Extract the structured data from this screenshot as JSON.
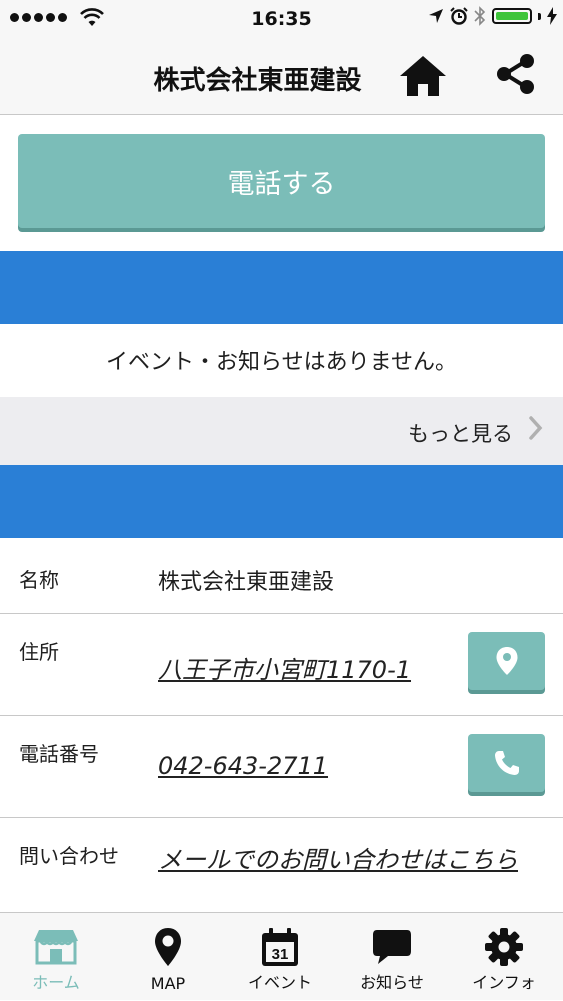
{
  "status_bar": {
    "time": "16:35"
  },
  "header": {
    "title": "株式会社東亜建設"
  },
  "call_button": {
    "label": "電話する"
  },
  "events": {
    "empty_message": "イベント・お知らせはありません。",
    "more_label": "もっと見る"
  },
  "info": {
    "name": {
      "label": "名称",
      "value": "株式会社東亜建設"
    },
    "address": {
      "label": "住所",
      "value": "八王子市小宮町1170-1"
    },
    "phone": {
      "label": "電話番号",
      "value": "042-643-2711"
    },
    "contact": {
      "label": "問い合わせ",
      "value": "メールでのお問い合わせはこちら"
    }
  },
  "tabs": [
    {
      "label": "ホーム",
      "icon": "store-icon",
      "active": true
    },
    {
      "label": "MAP",
      "icon": "map-pin-icon"
    },
    {
      "label": "イベント",
      "icon": "calendar-icon",
      "badge": "31"
    },
    {
      "label": "お知らせ",
      "icon": "chat-bubble-icon"
    },
    {
      "label": "インフォ",
      "icon": "gear-icon"
    }
  ],
  "colors": {
    "accent_teal": "#7bbdb8",
    "band_blue": "#2a7fd6",
    "battery_green": "#3ec43a"
  }
}
